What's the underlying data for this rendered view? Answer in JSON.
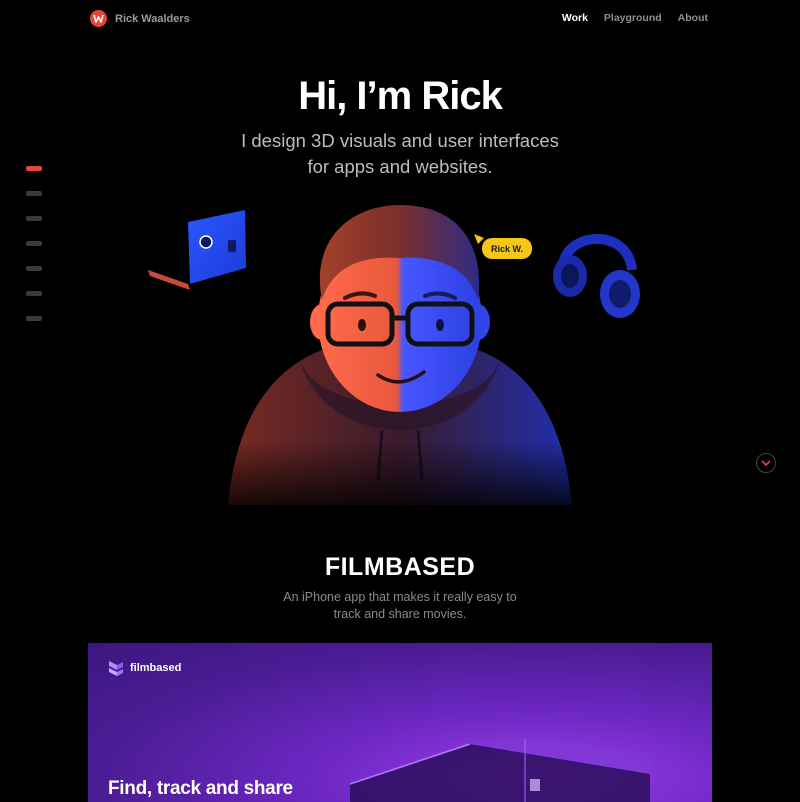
{
  "header": {
    "brand": "Rick Waalders",
    "nav": [
      {
        "label": "Work",
        "active": true
      },
      {
        "label": "Playground",
        "active": false
      },
      {
        "label": "About",
        "active": false
      }
    ]
  },
  "hero": {
    "title": "Hi, I’m Rick",
    "subtitle_line1": "I design 3D visuals and user interfaces",
    "subtitle_line2": "for apps and websites.",
    "name_tag": "Rick W."
  },
  "project": {
    "title": "FILMBASED",
    "desc_line1": "An iPhone app that makes it really easy to",
    "desc_line2": "track and share movies.",
    "card_brand": "filmbased",
    "card_headline": "Find, track and share"
  },
  "colors": {
    "accent": "#e5453b",
    "purple": "#6d27c3",
    "tag_yellow": "#f5c518"
  },
  "side_indicator": {
    "count": 7,
    "active_index": 0
  }
}
